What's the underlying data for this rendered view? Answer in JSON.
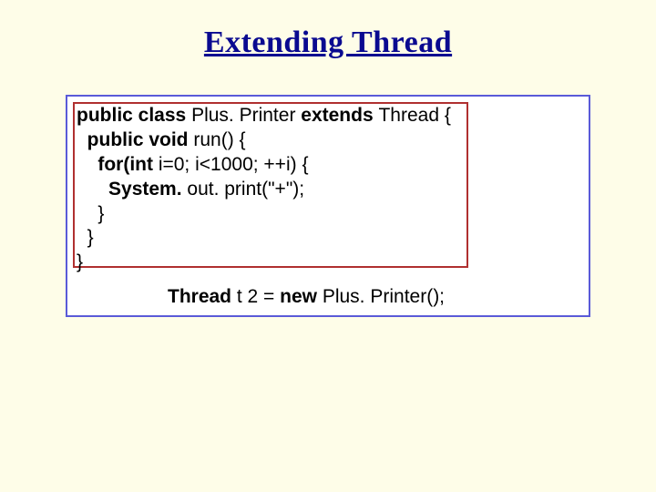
{
  "title": "Extending Thread",
  "code": {
    "l1a": "public class ",
    "l1b": "Plus. Printer ",
    "l1c": "extends ",
    "l1d": "Thread {",
    "l2a": "  public void ",
    "l2b": "run() {",
    "l3a": "    for(int ",
    "l3b": "i=0; i<1000; ++i) {",
    "l4a": "      System. ",
    "l4b": "out. print(\"+\");",
    "l5": "    }",
    "l6": "  }",
    "l7": "}"
  },
  "instantiate": {
    "a": "Thread ",
    "b": "t 2 = ",
    "c": "new ",
    "d": "Plus. Printer();"
  }
}
